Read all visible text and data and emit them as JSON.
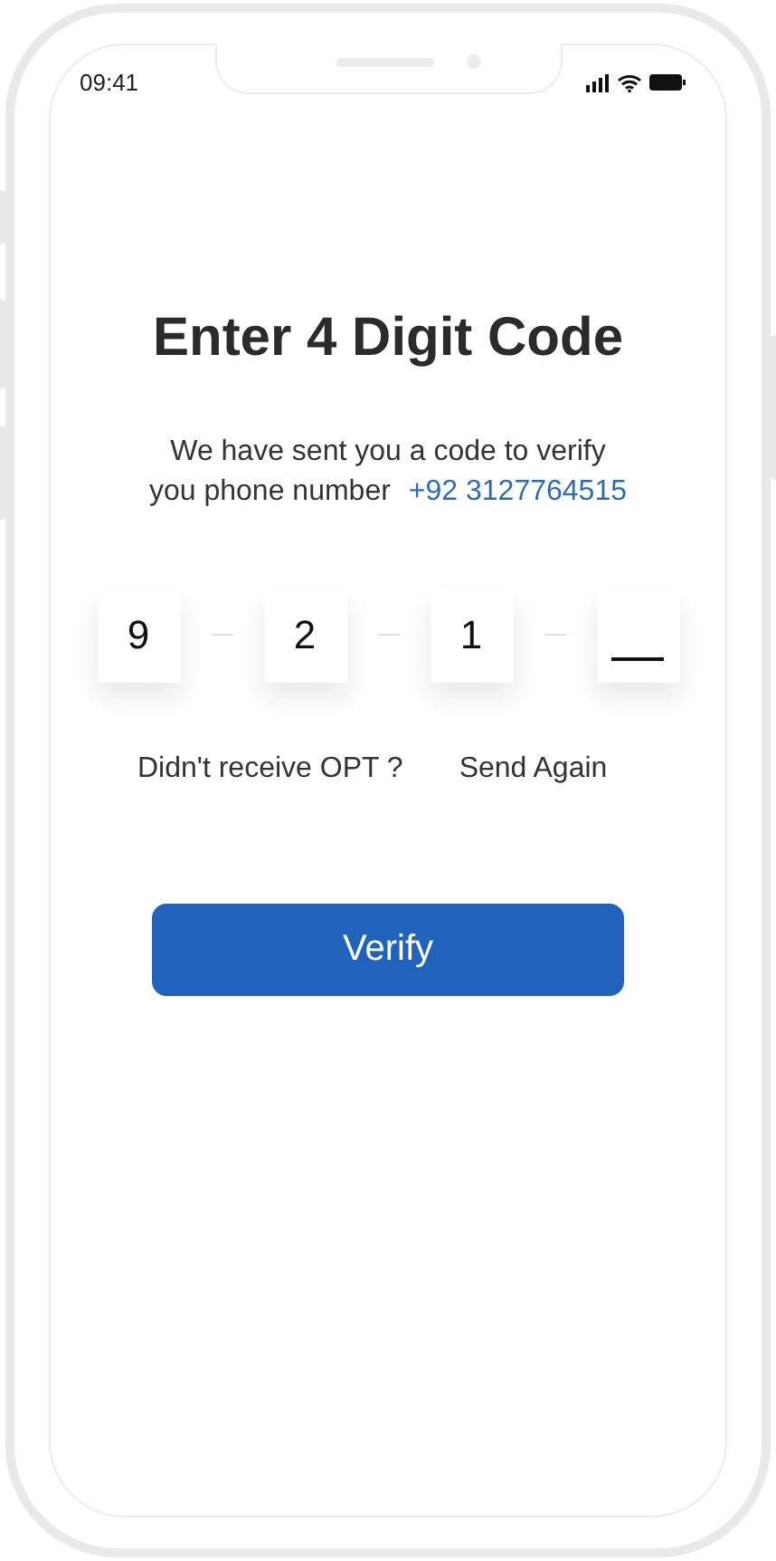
{
  "status_bar": {
    "time": "09:41"
  },
  "title": "Enter 4 Digit Code",
  "message": {
    "line_1": "We have sent you a code to verify",
    "line_2": "you phone number",
    "phone": "+92 3127764515"
  },
  "code_digits": [
    {
      "kind": "filled",
      "value": "9"
    },
    {
      "kind": "filled",
      "value": "2"
    },
    {
      "kind": "filled",
      "value": "1"
    },
    {
      "kind": "empty"
    }
  ],
  "resend": {
    "question": "Didn't receive OPT ?",
    "link": "Send Again"
  },
  "verify_button": "Verify"
}
